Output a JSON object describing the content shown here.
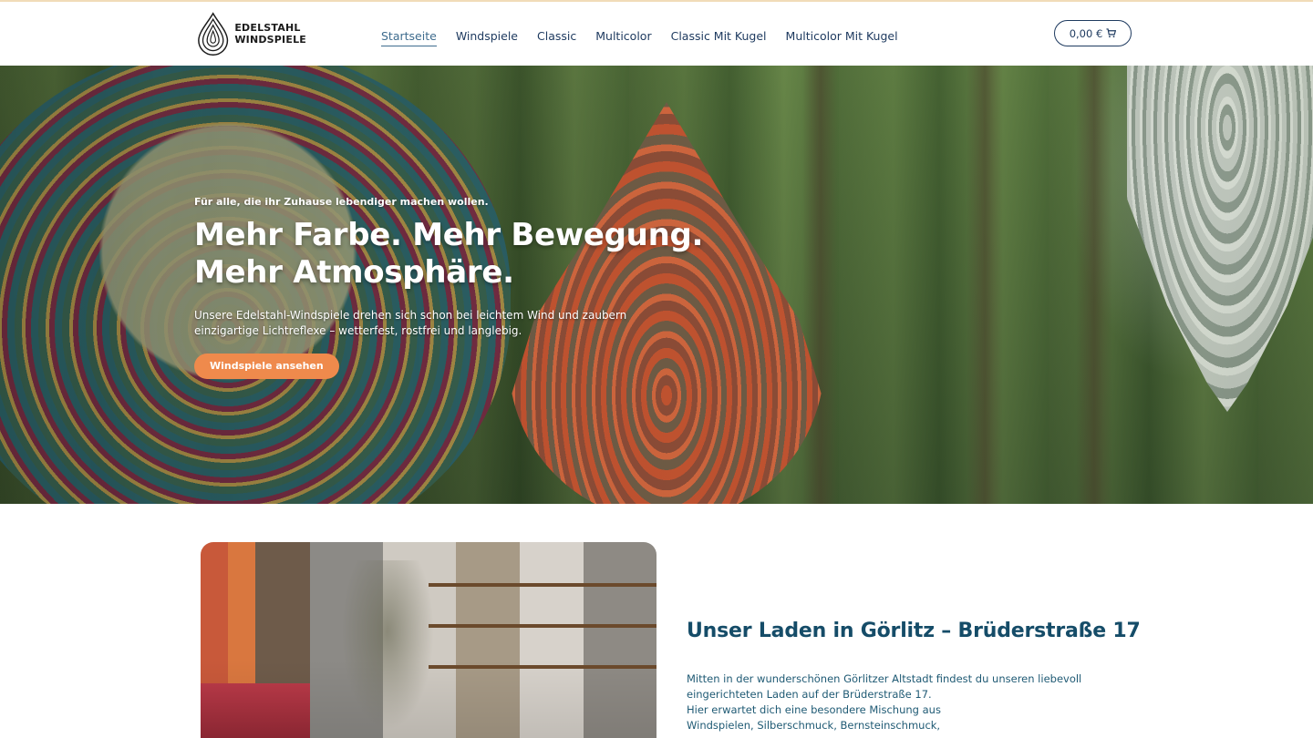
{
  "header": {
    "logo": {
      "line1": "EDELSTAHL",
      "line2": "WINDSPIELE",
      "icon": "teardrop-rings-icon"
    },
    "nav": [
      {
        "label": "Startseite",
        "active": true
      },
      {
        "label": "Windspiele",
        "active": false
      },
      {
        "label": "Classic",
        "active": false
      },
      {
        "label": "Multicolor",
        "active": false
      },
      {
        "label": "Classic Mit Kugel",
        "active": false
      },
      {
        "label": "Multicolor Mit Kugel",
        "active": false
      }
    ],
    "cart": {
      "amount": "0,00 €",
      "icon": "cart-icon"
    }
  },
  "hero": {
    "kicker": "Für alle, die ihr Zuhause lebendiger machen wollen.",
    "title_line1": "Mehr Farbe. Mehr Bewegung.",
    "title_line2": "Mehr Atmosphäre.",
    "text": "Unsere Edelstahl-Windspiele drehen sich schon bei leichtem Wind und zaubern einzigartige Lichtreflexe – wetterfest, rostfrei und langlebig.",
    "button": "Windspiele ansehen"
  },
  "shop": {
    "title": "Unser Laden in Görlitz – Brüderstraße 17",
    "paragraph_lines": [
      "Mitten in der wunderschönen Görlitzer Altstadt findest du unseren liebevoll",
      "eingerichteten Laden auf der Brüderstraße 17.",
      "Hier erwartet dich eine besondere Mischung aus",
      "Windspielen, Silberschmuck, Bernsteinschmuck,"
    ]
  },
  "colors": {
    "accent": "#ef8a4c",
    "nav_text": "#1f3b60",
    "heading": "#154c68",
    "body_text": "#1f5a74"
  }
}
